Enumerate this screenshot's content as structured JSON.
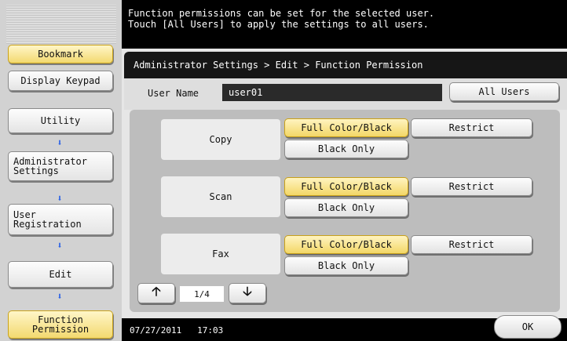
{
  "sidebar": {
    "bookmark_label": "Bookmark",
    "display_keypad_label": "Display Keypad",
    "breadcrumb_steps": [
      "Utility",
      "Administrator\nSettings",
      "User\nRegistration",
      "Edit",
      "Function\nPermission"
    ]
  },
  "header": {
    "message_line1": "Function permissions can be set for the selected user.",
    "message_line2": "Touch [All Users] to apply the settings to all users.",
    "breadcrumb": "Administrator Settings > Edit > Function Permission"
  },
  "user": {
    "label": "User Name",
    "value": "user01",
    "all_users_label": "All Users"
  },
  "permissions": [
    {
      "name": "Copy",
      "options": [
        "Full Color/Black",
        "Black Only",
        "Restrict"
      ],
      "selected": "Full Color/Black"
    },
    {
      "name": "Scan",
      "options": [
        "Full Color/Black",
        "Black Only",
        "Restrict"
      ],
      "selected": "Full Color/Black"
    },
    {
      "name": "Fax",
      "options": [
        "Full Color/Black",
        "Black Only",
        "Restrict"
      ],
      "selected": "Full Color/Black"
    }
  ],
  "pager": {
    "page": "1/4",
    "up_icon": "arrow-up-icon",
    "down_icon": "arrow-down-icon"
  },
  "footer": {
    "date": "07/27/2011",
    "time": "17:03",
    "ok_label": "OK"
  },
  "colors": {
    "selected": "#f3d767",
    "arrow": "#2c63e6"
  }
}
